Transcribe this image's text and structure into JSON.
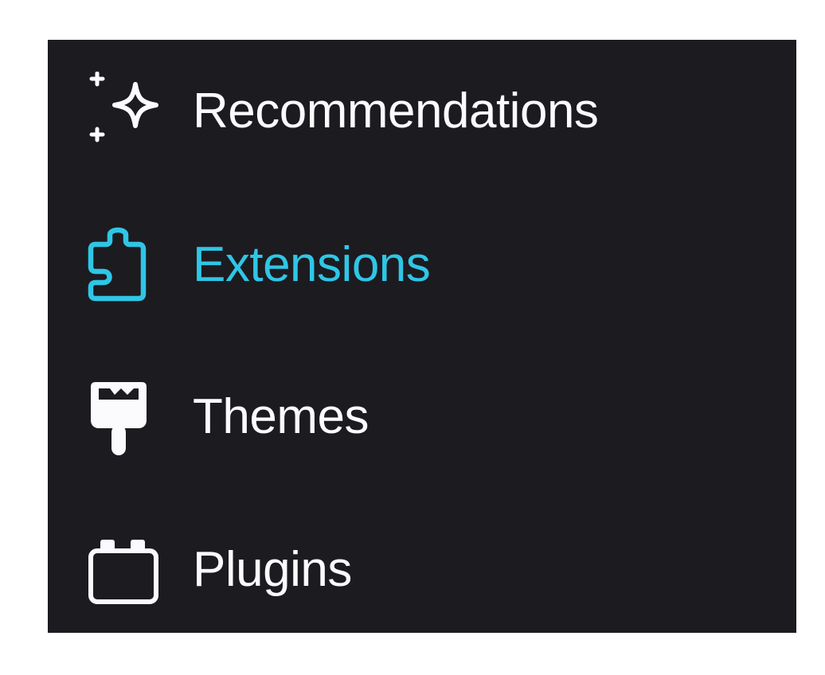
{
  "colors": {
    "panel_background": "#1c1b20",
    "text": "#fbfbfe",
    "accent": "#2fc6e6",
    "page_background": "#ffffff"
  },
  "nav": {
    "selected": "Extensions",
    "items": [
      {
        "label": "Recommendations",
        "icon": "sparkle-icon",
        "selected": false
      },
      {
        "label": "Extensions",
        "icon": "puzzle-piece-icon",
        "selected": true
      },
      {
        "label": "Themes",
        "icon": "paintbrush-icon",
        "selected": false
      },
      {
        "label": "Plugins",
        "icon": "plugin-icon",
        "selected": false
      }
    ]
  }
}
